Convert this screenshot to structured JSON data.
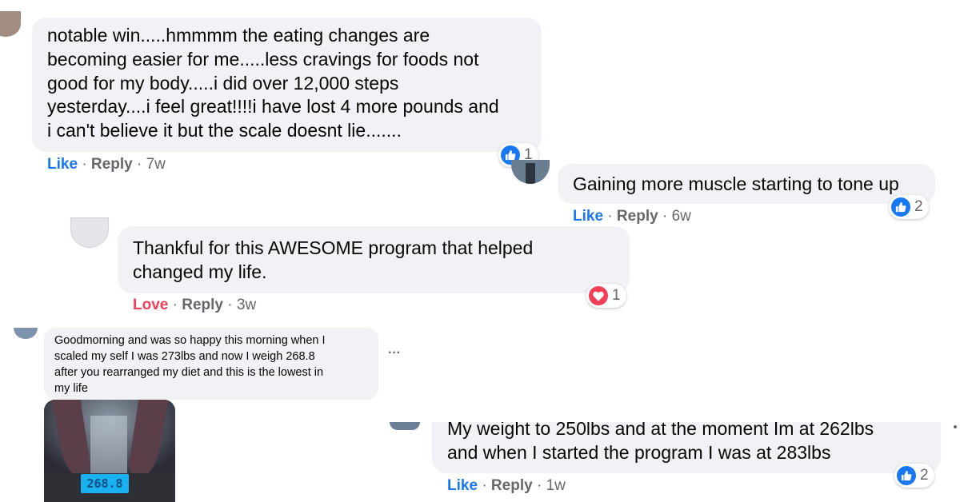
{
  "comments": [
    {
      "text": "notable win.....hmmmm the eating changes are\nbecoming easier for me.....less cravings for foods not\ngood for my body.....i did over 12,000 steps\nyesterday....i feel great!!!!i have lost 4 more pounds and\ni can't believe it but the scale doesnt lie.......",
      "reaction_label": "Like",
      "reply_label": "Reply",
      "time": "7w",
      "reaction_count": "1",
      "reaction_icon": "like-icon"
    },
    {
      "text": "Gaining more muscle starting to tone up",
      "reaction_label": "Like",
      "reply_label": "Reply",
      "time": "6w",
      "reaction_count": "2",
      "reaction_icon": "like-icon"
    },
    {
      "text": "Thankful for this AWESOME program that helped\nchanged my life.",
      "reaction_label": "Love",
      "reply_label": "Reply",
      "time": "3w",
      "reaction_count": "1",
      "reaction_icon": "love-icon"
    },
    {
      "text": "Goodmorning and was so happy this morning when I\nscaled my self I was 273lbs and now I weigh 268.8\nafter you rearranged my diet and this is the lowest in\nmy life",
      "more_label": "···",
      "scale_reading": "268.8"
    },
    {
      "text": "My weight to 250lbs and at the moment Im at 262lbs\nand when I started the program I was at 283lbs",
      "reaction_label": "Like",
      "reply_label": "Reply",
      "time": "1w",
      "reaction_count": "2",
      "reaction_icon": "like-icon"
    }
  ],
  "separator": "·",
  "colors": {
    "bubble": "#f0f2f5",
    "like_blue": "#1877f2",
    "love_red": "#f33e58",
    "meta_gray": "#65676b",
    "text": "#050505"
  }
}
